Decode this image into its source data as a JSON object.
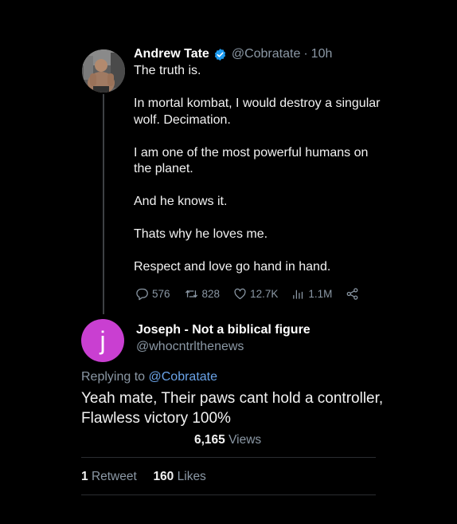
{
  "tweet": {
    "author_name": "Andrew Tate",
    "handle": "@Cobratate",
    "separator": "·",
    "time": "10h",
    "lines": [
      "The truth is.",
      "",
      "In mortal kombat, I would destroy a singular wolf. Decimation.",
      "",
      "I am one of the most powerful humans on the planet.",
      "",
      "And he knows it.",
      "",
      "Thats why he loves me.",
      "",
      "Respect and love go hand in hand."
    ],
    "actions": {
      "replies": "576",
      "retweets": "828",
      "likes": "12.7K",
      "views": "1.1M"
    }
  },
  "reply": {
    "avatar_letter": "j",
    "author_name": "Joseph - Not a biblical figure",
    "handle": "@whocntrlthenews",
    "replying_to_label": "Replying to",
    "replying_to_handle": "@Cobratate",
    "text": "Yeah mate, Their paws cant hold a controller, Flawless victory 100%",
    "views_count": "6,165",
    "views_label": "Views",
    "retweets_count": "1",
    "retweets_label": "Retweet",
    "likes_count": "160",
    "likes_label": "Likes"
  },
  "colors": {
    "background": "#000000",
    "verified_blue": "#1d9bf0",
    "link_blue": "#6aa3e8",
    "avatar_purple": "#c93fd1",
    "muted_text": "#8b98a5"
  },
  "icons": [
    "verified-badge-icon",
    "reply-icon",
    "retweet-icon",
    "like-icon",
    "views-icon",
    "share-icon"
  ]
}
